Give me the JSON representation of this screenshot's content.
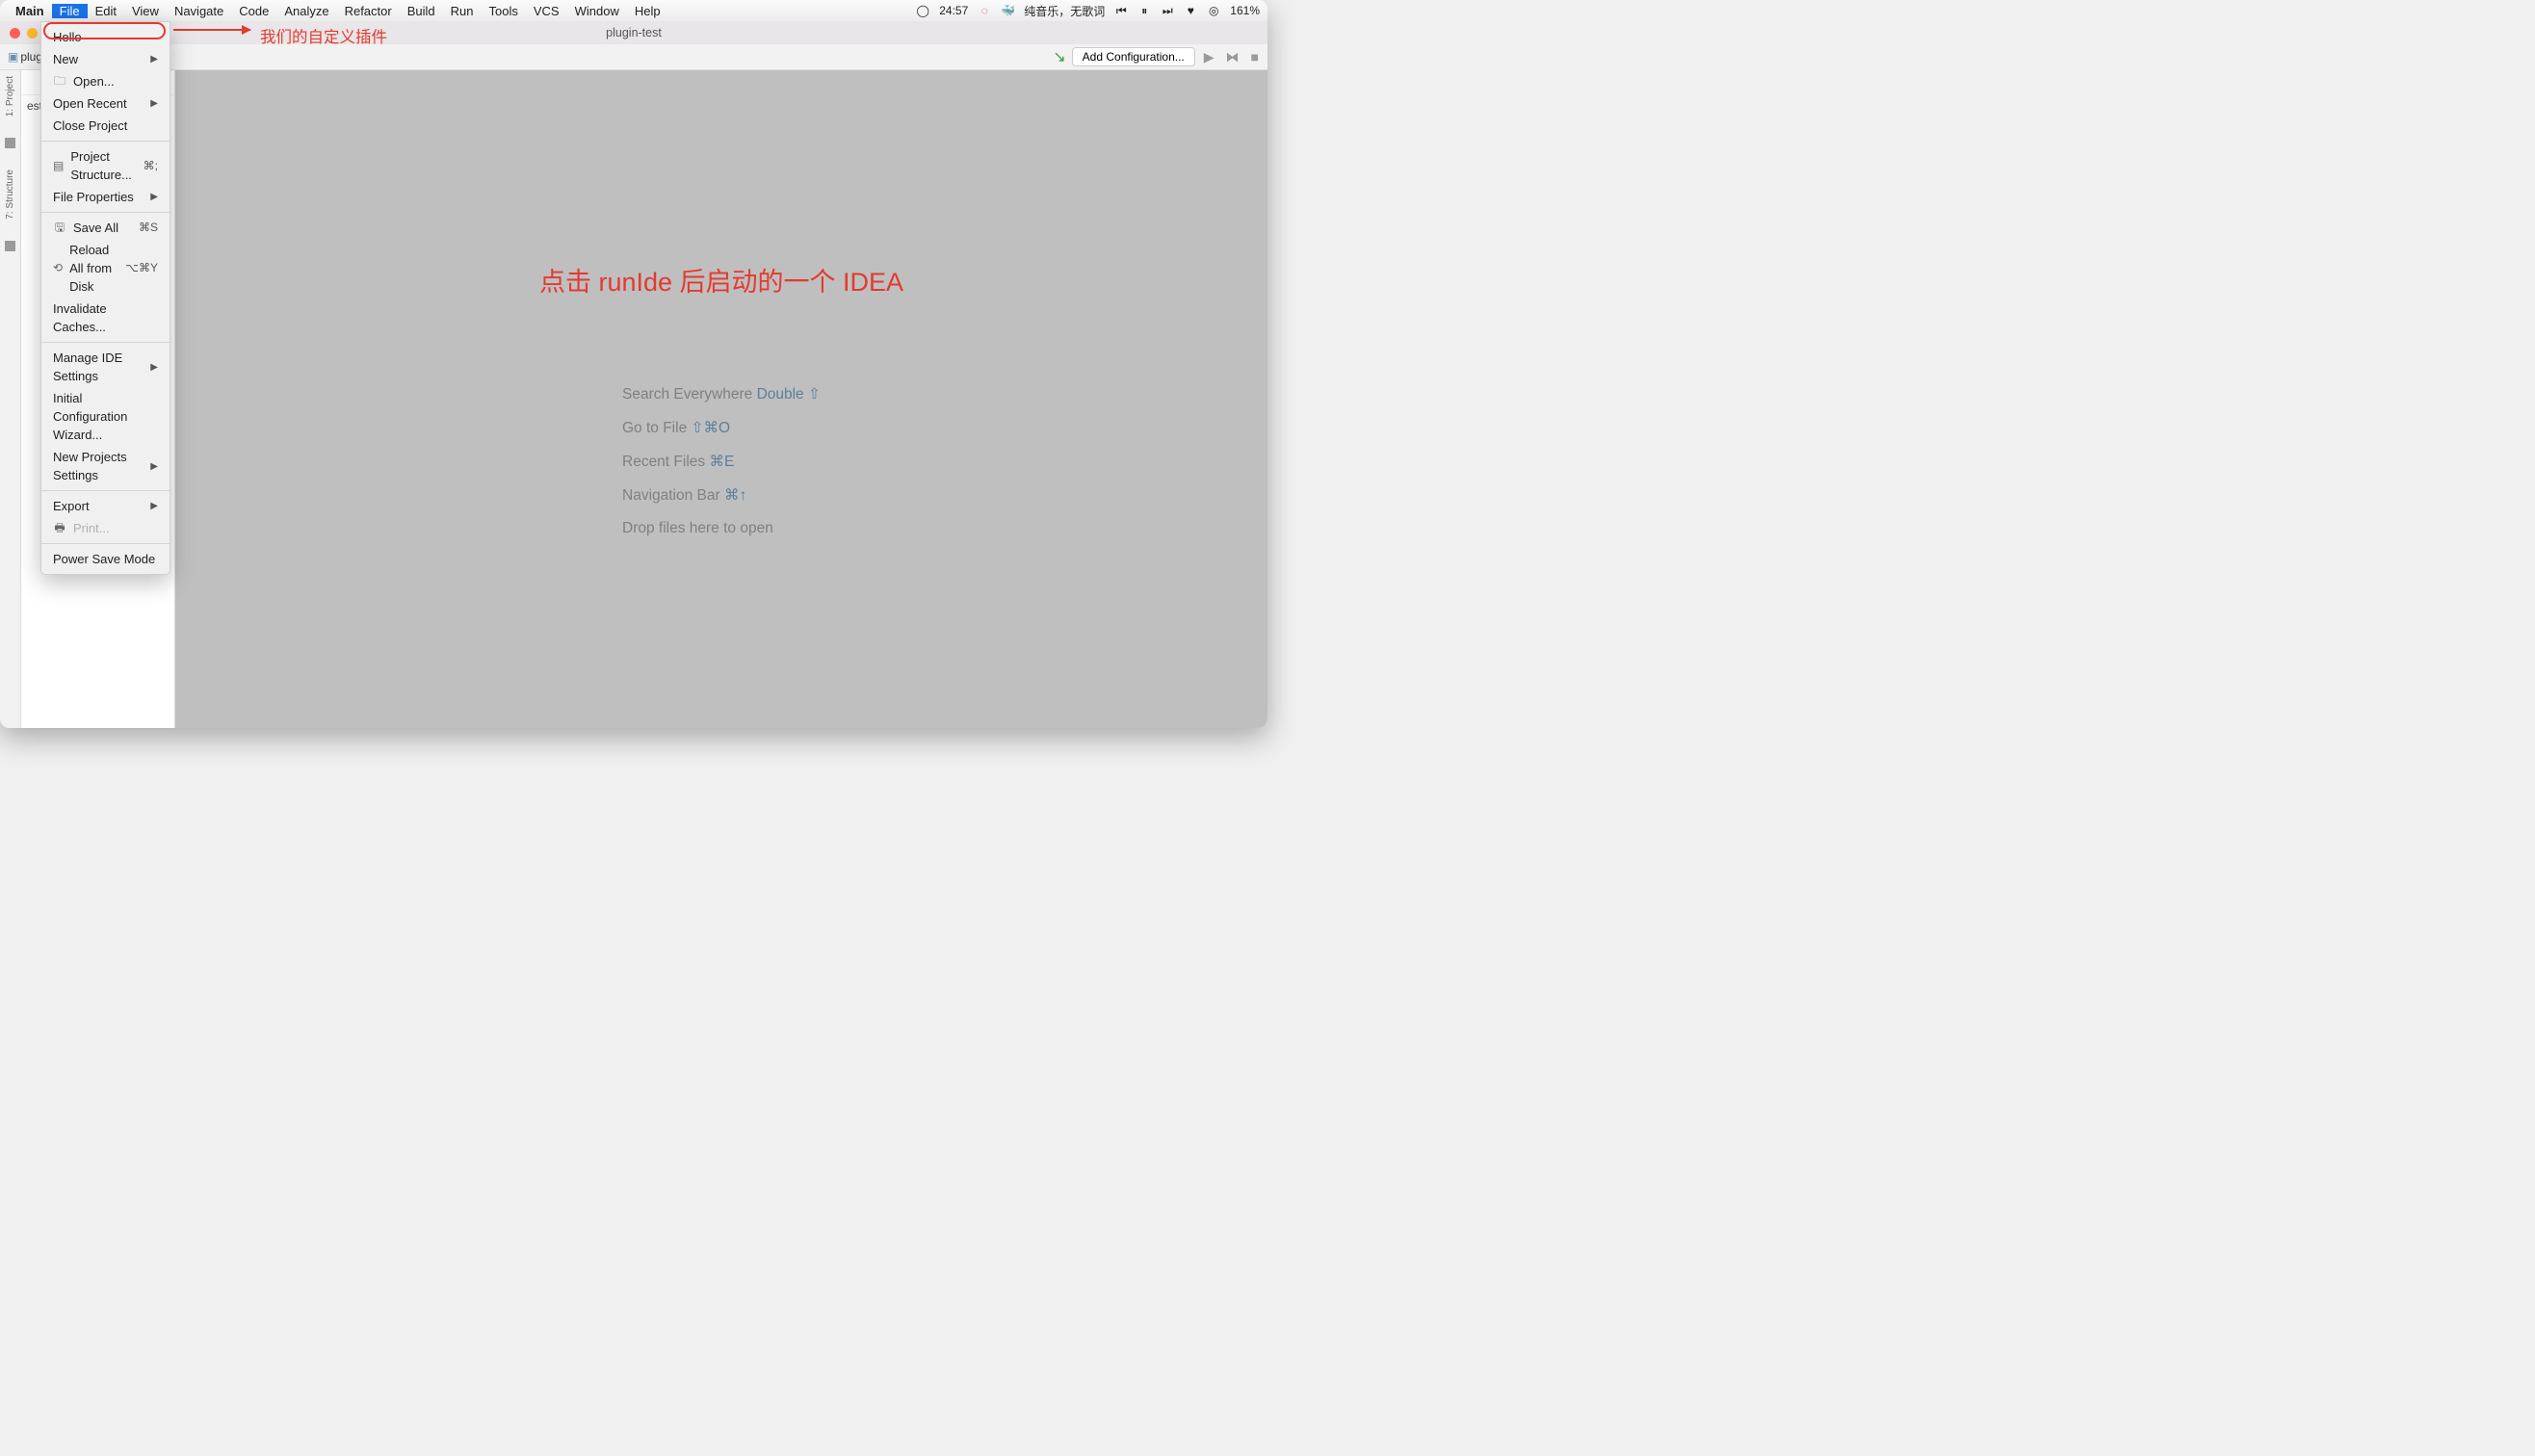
{
  "menubar": {
    "main": "Main",
    "file": "File",
    "items": [
      "Edit",
      "View",
      "Navigate",
      "Code",
      "Analyze",
      "Refactor",
      "Build",
      "Run",
      "Tools",
      "VCS",
      "Window",
      "Help"
    ],
    "clock": "24:57",
    "music": "纯音乐，无歌词",
    "pct": "161%"
  },
  "window": {
    "title": "plugin-test"
  },
  "toolbar": {
    "crumb": "plug",
    "add_config": "Add Configuration..."
  },
  "sidebar": {
    "project": "1: Project",
    "structure": "7: Structure"
  },
  "pane": {
    "tree_item": "est"
  },
  "file_menu": {
    "hello": "Hello",
    "new": "New",
    "open": "Open...",
    "open_recent": "Open Recent",
    "close_project": "Close Project",
    "project_structure": "Project Structure...",
    "project_structure_sc": "⌘;",
    "file_properties": "File Properties",
    "save_all": "Save All",
    "save_all_sc": "⌘S",
    "reload": "Reload All from Disk",
    "reload_sc": "⌥⌘Y",
    "invalidate": "Invalidate Caches...",
    "manage_ide": "Manage IDE Settings",
    "init_wizard": "Initial Configuration Wizard...",
    "new_projects": "New Projects Settings",
    "export": "Export",
    "print": "Print...",
    "power_save": "Power Save Mode"
  },
  "annotations": {
    "plugin_note": "我们的自定义插件",
    "big": "点击 runIde 后启动的一个 IDEA"
  },
  "hints": {
    "l1a": "Search Everywhere ",
    "l1b": "Double ⇧",
    "l2a": "Go to File ",
    "l2b": "⇧⌘O",
    "l3a": "Recent Files ",
    "l3b": "⌘E",
    "l4a": "Navigation Bar ",
    "l4b": "⌘↑",
    "l5": "Drop files here to open"
  }
}
